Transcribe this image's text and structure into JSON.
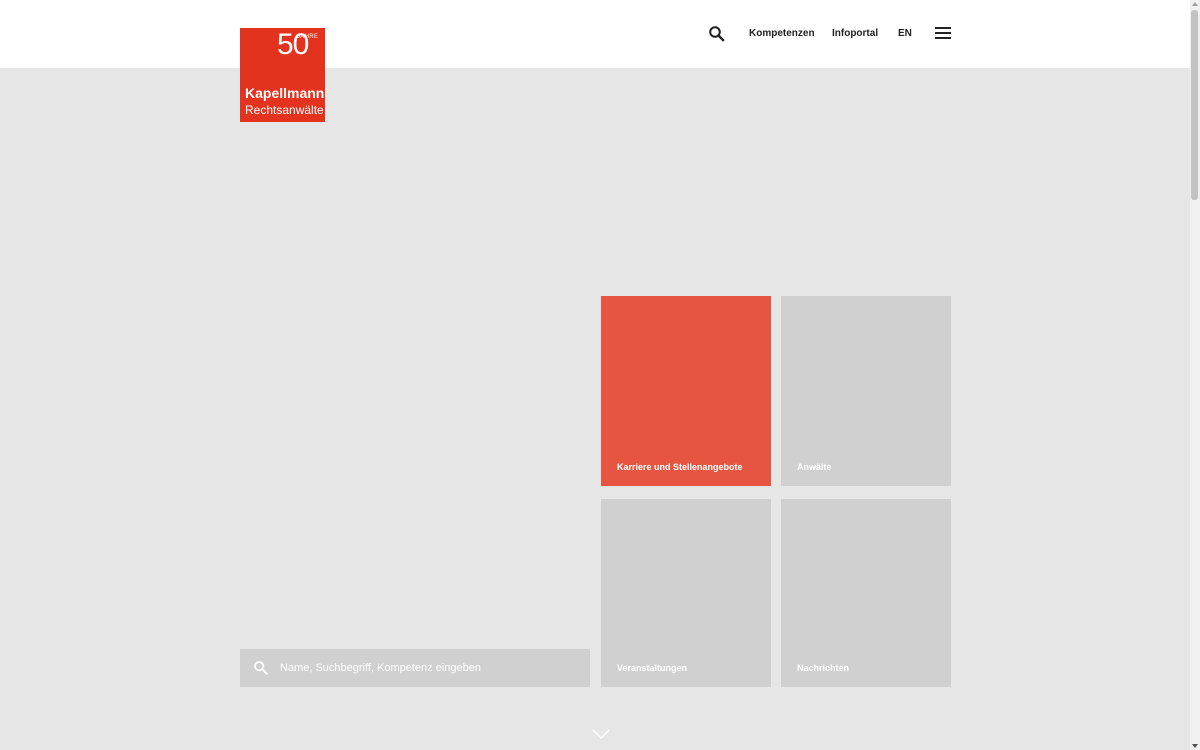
{
  "logo": {
    "anniversary_number": "50",
    "anniversary_word": "JAHRE",
    "name": "Kapellmann",
    "subtitle": "Rechtsanwälte",
    "brand_color": "#e3321e"
  },
  "nav": {
    "search_icon": "search-icon",
    "links": [
      "Kompetenzen",
      "Infoportal",
      "EN"
    ],
    "menu_icon": "hamburger-menu-icon"
  },
  "tiles": [
    {
      "label": "Karriere und Stellenangebote",
      "color": "#e55542"
    },
    {
      "label": "Anwälte",
      "color": "#d0d0d0"
    },
    {
      "label": "Veranstaltungen",
      "color": "#d0d0d0"
    },
    {
      "label": "Nachrichten",
      "color": "#d0d0d0"
    }
  ],
  "search": {
    "placeholder": "Name, Suchbegriff, Kompetenz eingeben",
    "icon": "search-icon"
  },
  "scroll_indicator": "chevron-down-icon",
  "colors": {
    "background": "#e6e6e6",
    "header": "#ffffff",
    "tile_grey": "#d0d0d0"
  }
}
